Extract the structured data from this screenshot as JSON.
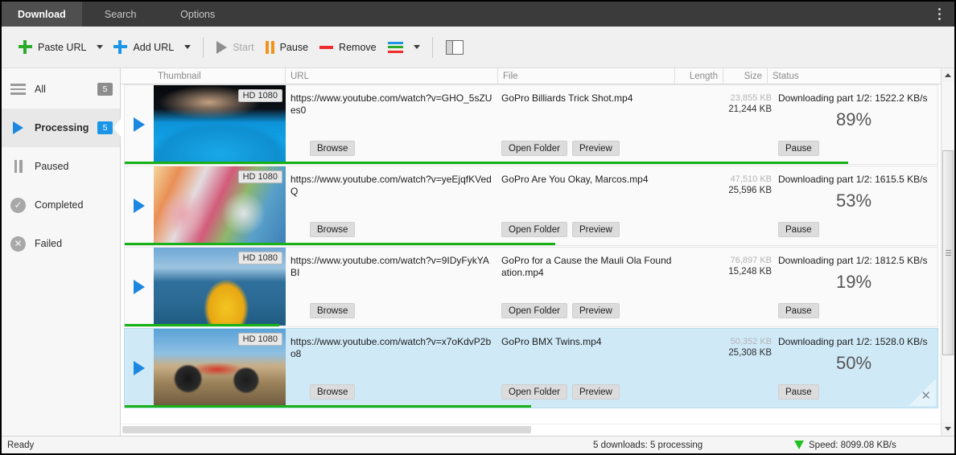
{
  "window": {
    "tabs": [
      {
        "label": "Download",
        "active": true
      },
      {
        "label": "Search",
        "active": false
      },
      {
        "label": "Options",
        "active": false
      }
    ],
    "menu_icon": "overflow-menu-icon"
  },
  "toolbar": {
    "paste_url": "Paste URL",
    "add_url": "Add URL",
    "start": "Start",
    "pause": "Pause",
    "remove": "Remove",
    "colors_icon": "color-lines-icon",
    "panel_toggle_icon": "panel-toggle-icon"
  },
  "sidebar": {
    "items": [
      {
        "label": "All",
        "badge": "5",
        "badge_color": "#8c8c8c",
        "icon": "burger-icon",
        "active": false
      },
      {
        "label": "Processing",
        "badge": "5",
        "badge_color": "#1b95e8",
        "icon": "play-icon",
        "active": true
      },
      {
        "label": "Paused",
        "badge": "",
        "icon": "pause-icon",
        "active": false
      },
      {
        "label": "Completed",
        "badge": "",
        "icon": "check-circle-icon",
        "active": false
      },
      {
        "label": "Failed",
        "badge": "",
        "icon": "x-circle-icon",
        "active": false
      }
    ]
  },
  "list": {
    "columns": [
      {
        "key": "thumbnail",
        "label": "Thumbnail"
      },
      {
        "key": "url",
        "label": "URL"
      },
      {
        "key": "file",
        "label": "File"
      },
      {
        "key": "length",
        "label": "Length"
      },
      {
        "key": "size",
        "label": "Size"
      },
      {
        "key": "status",
        "label": "Status"
      }
    ],
    "buttons": {
      "browse": "Browse",
      "open_folder": "Open Folder",
      "preview": "Preview",
      "pause": "Pause"
    },
    "rows": [
      {
        "quality_badge": "HD 1080",
        "url": "https://www.youtube.com/watch?v=GHO_5sZUes0",
        "file": "GoPro  Billiards Trick Shot.mp4",
        "length": "",
        "size_total": "23,855 KB",
        "size_done": "21,244 KB",
        "status": "Downloading part 1/2: 1522.2 KB/s",
        "percent_label": "89%",
        "percent": 89,
        "selected": false,
        "closable": false,
        "thumb": "billiards"
      },
      {
        "quality_badge": "HD 1080",
        "url": "https://www.youtube.com/watch?v=yeEjqfKVedQ",
        "file": "GoPro  Are You Okay, Marcos.mp4",
        "length": "",
        "size_total": "47,510 KB",
        "size_done": "25,596 KB",
        "status": "Downloading part 1/2: 1615.5 KB/s",
        "percent_label": "53%",
        "percent": 53,
        "selected": false,
        "closable": false,
        "thumb": "kids"
      },
      {
        "quality_badge": "HD 1080",
        "url": "https://www.youtube.com/watch?v=9IDyFykYABI",
        "file": "GoPro for a Cause  the Mauli Ola Foundation.mp4",
        "length": "",
        "size_total": "76,897 KB",
        "size_done": "15,248 KB",
        "status": "Downloading part 1/2: 1812.5 KB/s",
        "percent_label": "19%",
        "percent": 19,
        "selected": false,
        "closable": false,
        "thumb": "kayak"
      },
      {
        "quality_badge": "HD 1080",
        "url": "https://www.youtube.com/watch?v=x7oKdvP2bo8",
        "file": "GoPro  BMX Twins.mp4",
        "length": "",
        "size_total": "50,352 KB",
        "size_done": "25,308 KB",
        "status": "Downloading part 1/2: 1528.0 KB/s",
        "percent_label": "50%",
        "percent": 50,
        "selected": true,
        "closable": true,
        "thumb": "bmx"
      }
    ]
  },
  "statusbar": {
    "ready": "Ready",
    "downloads": "5 downloads: 5 processing",
    "speed": "Speed: 8099.08 KB/s"
  },
  "colors": {
    "accent_blue": "#1b95e8",
    "progress_green": "#16b216",
    "selection_blue": "#cfe9f7",
    "titlebar": "#3b3b3b"
  }
}
